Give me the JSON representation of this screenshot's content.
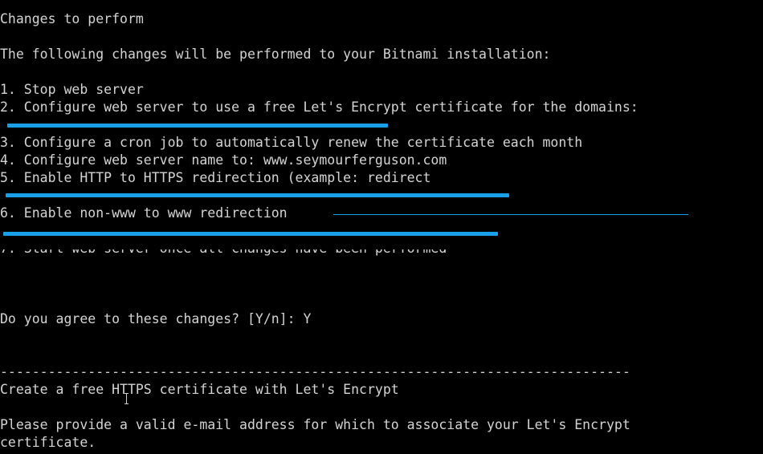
{
  "terminal": {
    "separator": "-------------------------------------------------------------------------------",
    "heading_changes": "Changes to perform",
    "intro": "The following changes will be performed to your Bitnami installation:",
    "steps": [
      "1. Stop web server",
      "2. Configure web server to use a free Let's Encrypt certificate for the domains:",
      "3. Configure a cron job to automatically renew the certificate each month",
      "4. Configure web server name to: www.seymourferguson.com",
      "5. Enable HTTP to HTTPS redirection (example: redirect",
      "6. Enable non-www to www redirection",
      "7. Start web server once all changes have been performed"
    ],
    "prompt_agree": "Do you agree to these changes? [Y/n]: Y",
    "heading_create": "Create a free HTTPS certificate with Let's Encrypt",
    "email_request_line1": "Please provide a valid e-mail address for which to associate your Let's Encrypt",
    "email_request_line2": "certificate."
  },
  "colors": {
    "background": "#000000",
    "text": "#d4d4d4",
    "redaction": "#1aa0e8"
  }
}
